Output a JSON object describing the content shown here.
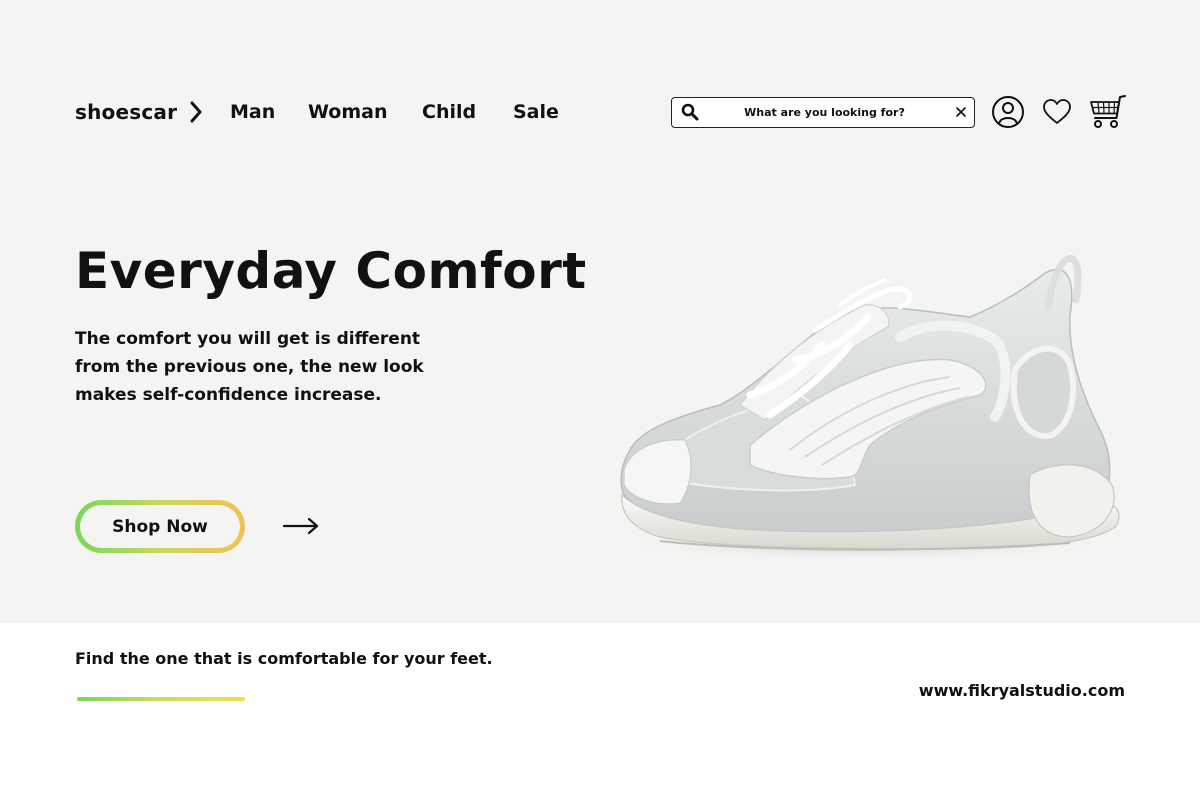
{
  "brand": {
    "name": "shoescar",
    "chevron_icon": "chevron-right-icon"
  },
  "nav": {
    "links": [
      {
        "label": "Man"
      },
      {
        "label": "Woman"
      },
      {
        "label": "Child"
      },
      {
        "label": "Sale"
      }
    ]
  },
  "search": {
    "placeholder": "What are you looking for?",
    "value": "",
    "icon": "search-icon",
    "clear_icon": "close-icon"
  },
  "header_icons": [
    "user-account-icon",
    "heart-icon",
    "shopping-cart-icon"
  ],
  "hero": {
    "headline": "Everyday Comfort",
    "subcopy": "The comfort you will get is different from the previous one, the new look makes self-confidence increase.",
    "cta_label": "Shop Now",
    "cta_arrow_icon": "arrow-right-icon",
    "product_image": "white-sneaker-image"
  },
  "footer": {
    "tagline": "Find the one that is comfortable for your feet.",
    "website": "www.fikryalstudio.com"
  },
  "colors": {
    "hero_background": "#f4f4f2",
    "text": "#111111",
    "gradient_green": "#79d65a",
    "gradient_yellow": "#f2c152"
  }
}
